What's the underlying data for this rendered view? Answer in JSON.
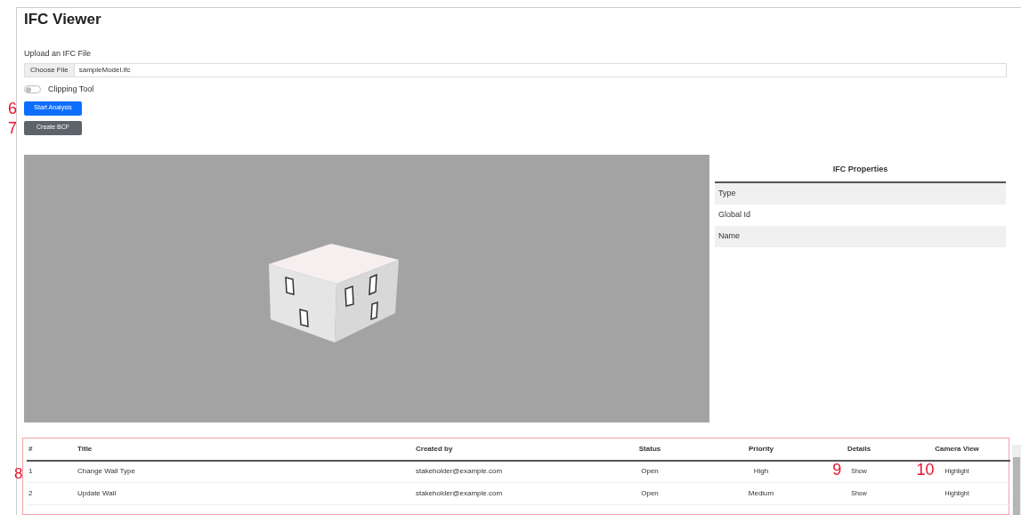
{
  "title": "IFC Viewer",
  "upload": {
    "label": "Upload an IFC File",
    "button": "Choose File",
    "file_name": "sampleModel.ifc"
  },
  "clipping": {
    "label": "Clipping Tool",
    "on": false
  },
  "buttons": [
    {
      "label": "Start Analysis",
      "kind": "primary",
      "marker": "6"
    },
    {
      "label": "Create BCF",
      "kind": "secondary",
      "marker": "7"
    }
  ],
  "properties": {
    "title": "IFC Properties",
    "rows": [
      "Type",
      "Global Id",
      "Name"
    ]
  },
  "issues": {
    "columns": [
      "#",
      "Title",
      "Created by",
      "Status",
      "Priority",
      "Details",
      "Camera View"
    ],
    "rows": [
      {
        "marker": "8",
        "number": "1",
        "title": "Change Wall Type",
        "created_by": "stakeholder@example.com",
        "status": "Open",
        "priority": "High",
        "details": {
          "label": "Show",
          "marker": "9"
        },
        "camera": {
          "label": "Highlight",
          "marker": "10"
        }
      },
      {
        "number": "2",
        "title": "Update Wall",
        "created_by": "stakeholder@example.com",
        "status": "Open",
        "priority": "Medium",
        "details": {
          "label": "Show"
        },
        "camera": {
          "label": "Highlight"
        }
      }
    ]
  }
}
